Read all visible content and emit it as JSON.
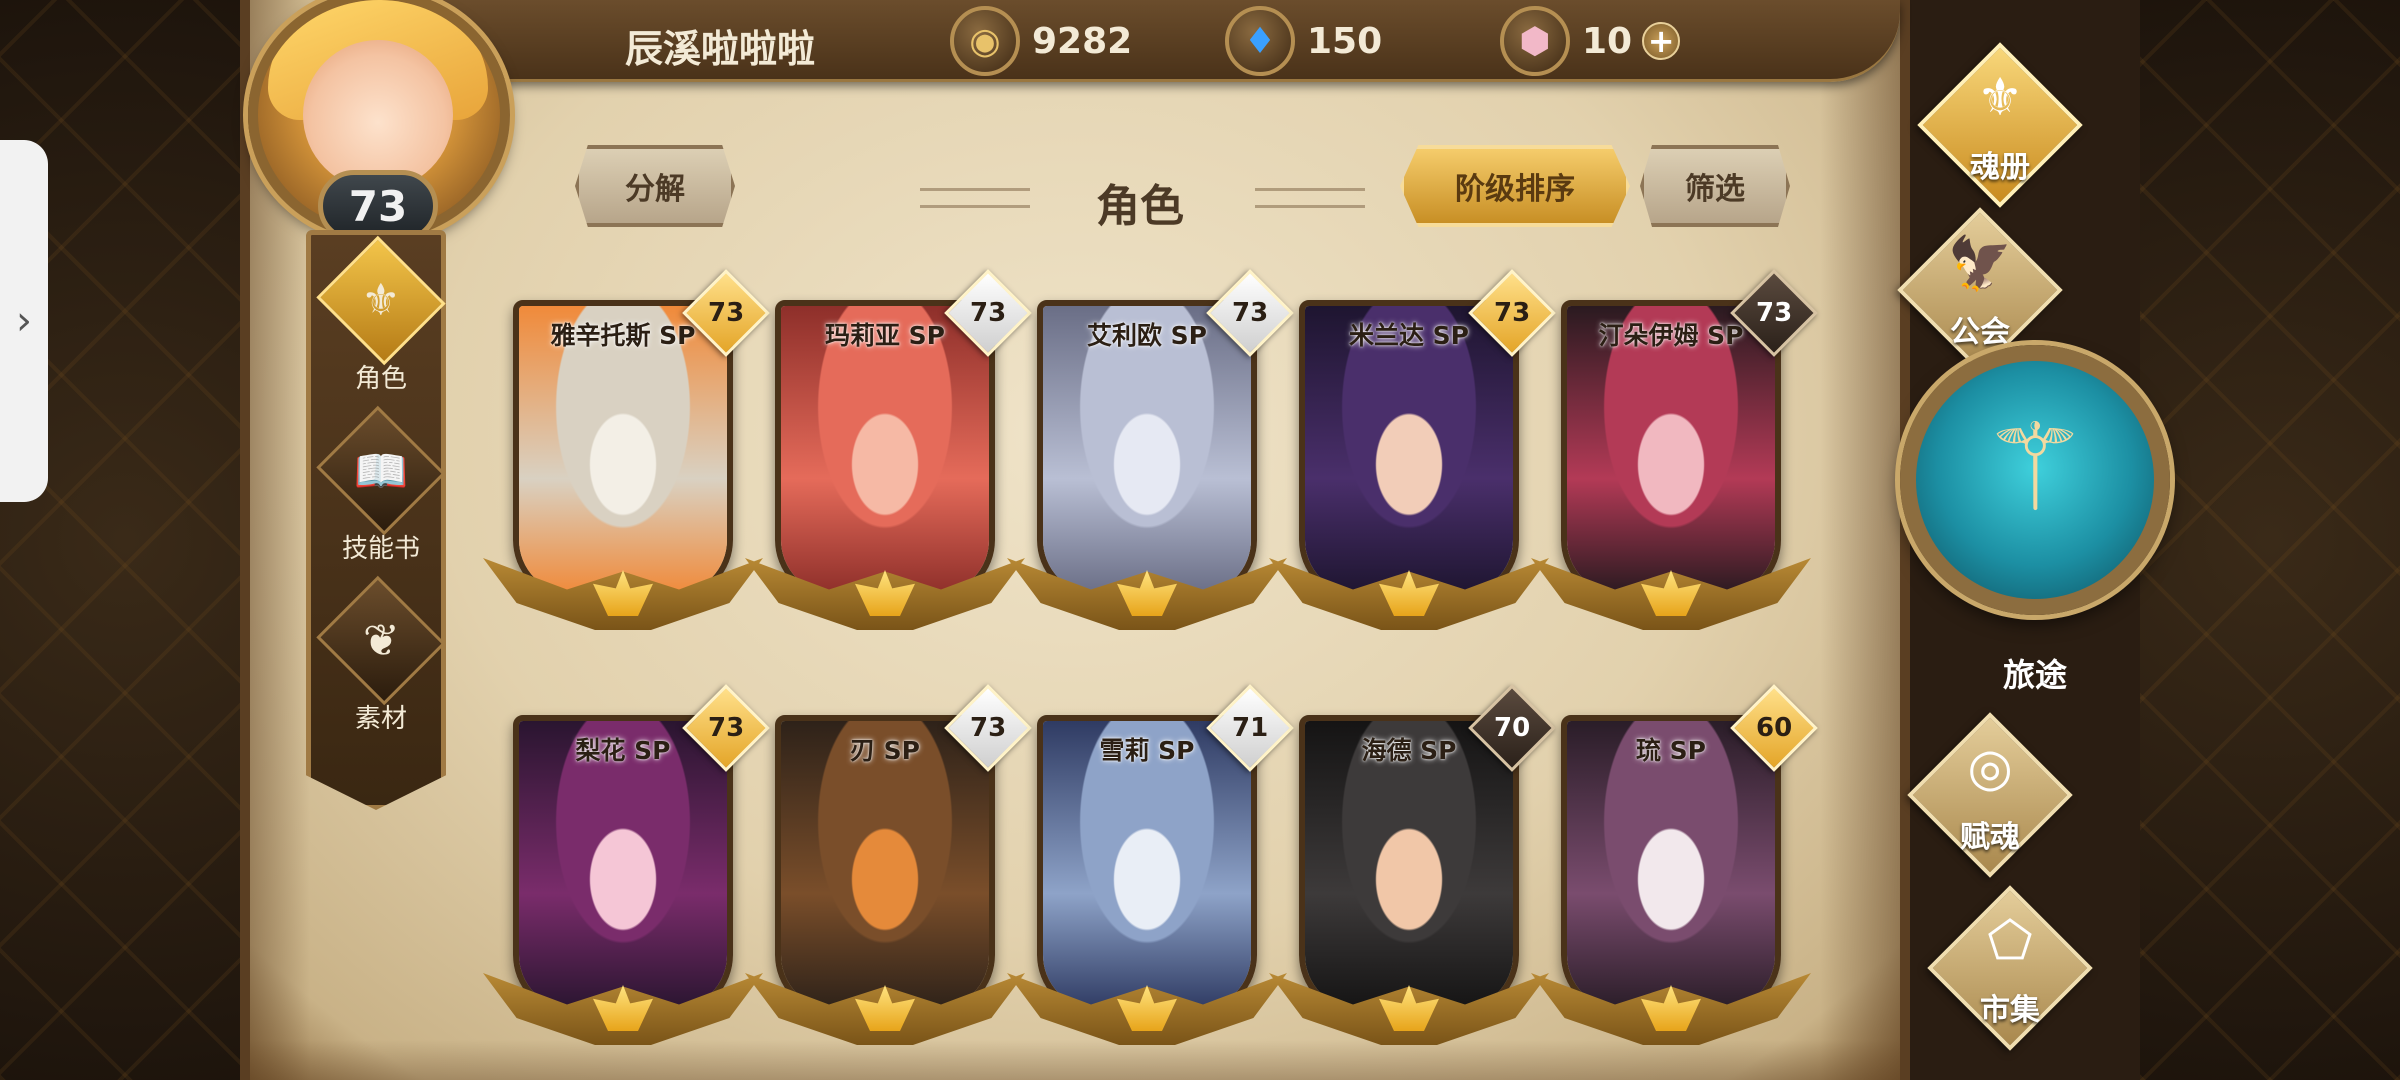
{
  "player": {
    "name": "辰溪啦啦啦",
    "level": "73"
  },
  "resources": {
    "gold": {
      "icon": "gold-coin-icon",
      "value": "9282"
    },
    "crystal": {
      "icon": "blue-crystal-icon",
      "value": "150"
    },
    "gem": {
      "icon": "pink-gem-icon",
      "value": "10",
      "plus": "+"
    }
  },
  "header": {
    "title": "角色",
    "decompose_label": "分解",
    "sort_label": "阶级排序",
    "filter_label": "筛选"
  },
  "sidenav": {
    "items": [
      {
        "label": "角色",
        "icon": "helmet-icon",
        "glyph": "⚜",
        "active": true
      },
      {
        "label": "技能书",
        "icon": "skill-book-icon",
        "glyph": "📖",
        "active": false
      },
      {
        "label": "素材",
        "icon": "material-icon",
        "glyph": "❦",
        "active": false
      }
    ]
  },
  "cards": [
    {
      "name": "雅辛托斯 SP",
      "level": "73",
      "badge": "gold",
      "palette": [
        "#f3efe6",
        "#d9d1c2",
        "#f08a3a"
      ]
    },
    {
      "name": "玛莉亚 SP",
      "level": "73",
      "badge": "silver",
      "palette": [
        "#f6b9a5",
        "#e56b5a",
        "#8e2f2a"
      ]
    },
    {
      "name": "艾利欧 SP",
      "level": "73",
      "badge": "silver",
      "palette": [
        "#e6e9f3",
        "#b9bfd4",
        "#6a6e86"
      ]
    },
    {
      "name": "米兰达 SP",
      "level": "73",
      "badge": "gold",
      "palette": [
        "#f2cdb8",
        "#4a2f6b",
        "#1e1530"
      ]
    },
    {
      "name": "汀朵伊姆 SP",
      "level": "73",
      "badge": "dark",
      "palette": [
        "#f1b8c0",
        "#b33a56",
        "#2a1a20"
      ]
    },
    {
      "name": "梨花 SP",
      "level": "73",
      "badge": "gold",
      "palette": [
        "#f5c6d6",
        "#7a2c6b",
        "#2a1530"
      ]
    },
    {
      "name": "刃 SP",
      "level": "73",
      "badge": "silver",
      "palette": [
        "#e58a3a",
        "#7a4e2a",
        "#2e2219"
      ]
    },
    {
      "name": "雪莉 SP",
      "level": "71",
      "badge": "silver",
      "palette": [
        "#e9eef6",
        "#8ea3c8",
        "#2f3b63"
      ]
    },
    {
      "name": "海德 SP",
      "level": "70",
      "badge": "dark",
      "palette": [
        "#f1c7a8",
        "#3d3a3a",
        "#151414"
      ]
    },
    {
      "name": "琉 SP",
      "level": "60",
      "badge": "gold",
      "palette": [
        "#f2e8ec",
        "#7a4c6e",
        "#2a1d28"
      ]
    }
  ],
  "right_menu": {
    "items": [
      {
        "label": "魂册",
        "icon": "soul-book-icon",
        "glyph": "⚜",
        "active": true
      },
      {
        "label": "公会",
        "icon": "guild-icon",
        "glyph": "🦅",
        "active": false
      },
      {
        "label": "赋魂",
        "icon": "soul-swirl-icon",
        "glyph": "◎",
        "active": false
      },
      {
        "label": "市集",
        "icon": "market-icon",
        "glyph": "⬠",
        "active": false
      }
    ],
    "journey": {
      "label": "旅途",
      "icon": "journey-emblem-icon",
      "glyph": "⚚"
    }
  },
  "colors": {
    "accent_gold": "#e4a528",
    "parchment": "#e2d1ad",
    "frame_brown": "#4a3219"
  }
}
